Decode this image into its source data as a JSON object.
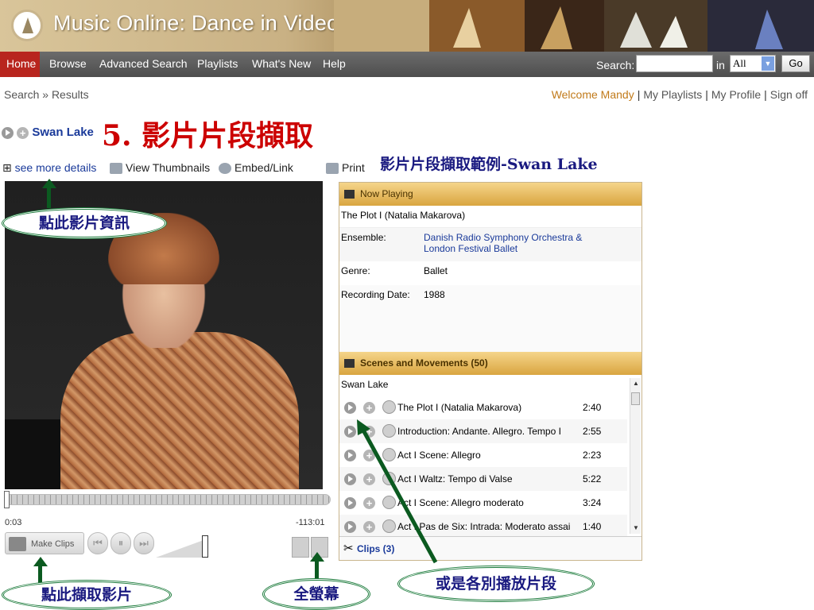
{
  "banner": {
    "title": "Music Online: Dance in Video"
  },
  "nav": {
    "items": [
      "Home",
      "Browse",
      "Advanced Search",
      "Playlists",
      "What's New",
      "Help"
    ],
    "search_label": "Search:",
    "search_value": "",
    "in_label": "in",
    "scope_value": "All",
    "go_label": "Go"
  },
  "breadcrumb": {
    "search": "Search",
    "sep": "»",
    "results": "Results"
  },
  "user": {
    "welcome": "Welcome Mandy",
    "playlists": "My Playlists",
    "profile": "My Profile",
    "signoff": "Sign off"
  },
  "slide": {
    "heading": "5. 影片片段擷取",
    "subheading": "影片片段擷取範例-Swan Lake"
  },
  "work": {
    "title": "Swan Lake"
  },
  "toolbar": {
    "details": "see more details",
    "thumbnails": "View Thumbnails",
    "embed": "Embed/Link",
    "print": "Print"
  },
  "player": {
    "time_elapsed": "0:03",
    "time_remaining": "-113:01",
    "make_clips": "Make Clips"
  },
  "now_playing": {
    "header": "Now Playing",
    "title": "The Plot I (Natalia Makarova)",
    "ensemble_label": "Ensemble:",
    "ensemble_value": "Danish Radio Symphony Orchestra & London Festival Ballet",
    "genre_label": "Genre:",
    "genre_value": "Ballet",
    "date_label": "Recording Date:",
    "date_value": "1988"
  },
  "scenes": {
    "header": "Scenes and Movements (50)",
    "top_item": "Swan Lake",
    "rows": [
      {
        "title": "The Plot I (Natalia Makarova)",
        "duration": "2:40"
      },
      {
        "title": "Introduction: Andante. Allegro. Tempo I",
        "duration": "2:55"
      },
      {
        "title": "Act I Scene: Allegro",
        "duration": "2:23"
      },
      {
        "title": "Act I Waltz: Tempo di Valse",
        "duration": "5:22"
      },
      {
        "title": "Act I Scene: Allegro moderato",
        "duration": "3:24"
      },
      {
        "title": "Act I Pas de Six: Intrada: Moderato assai",
        "duration": "1:40"
      }
    ],
    "clips_label": "Clips (3)"
  },
  "callouts": {
    "info": "點此影片資訊",
    "clip": "點此擷取影片",
    "fullscreen": "全螢幕",
    "play_segments": "或是各別播放片段"
  },
  "colors": {
    "heading": "#cc0000",
    "nav_active": "#b8251e",
    "accent": "#d9a540",
    "link": "#1a3a9a",
    "callout_border": "#1a7a3a"
  }
}
